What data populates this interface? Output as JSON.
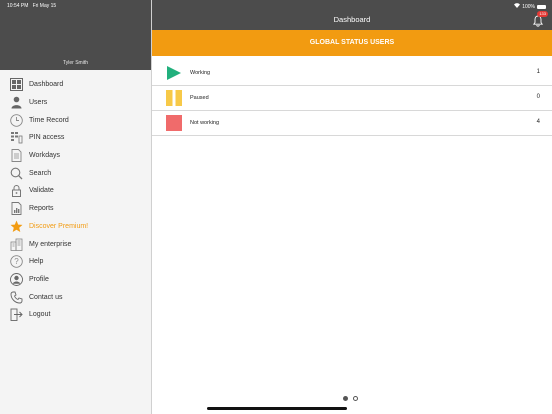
{
  "status_bar": {
    "time": "10:54 PM",
    "date": "Fri May 15",
    "battery": "100%"
  },
  "sidebar": {
    "user_name": "Tyler Smith",
    "items": [
      {
        "label": "Dashboard",
        "icon": "dashboard-icon"
      },
      {
        "label": "Users",
        "icon": "user-icon"
      },
      {
        "label": "Time Record",
        "icon": "clock-icon"
      },
      {
        "label": "PIN access",
        "icon": "keypad-icon"
      },
      {
        "label": "Workdays",
        "icon": "document-icon"
      },
      {
        "label": "Search",
        "icon": "search-icon"
      },
      {
        "label": "Validate",
        "icon": "lock-icon"
      },
      {
        "label": "Reports",
        "icon": "report-icon"
      },
      {
        "label": "Discover Premium!",
        "icon": "star-icon"
      },
      {
        "label": "My enterprise",
        "icon": "building-icon"
      },
      {
        "label": "Help",
        "icon": "help-icon"
      },
      {
        "label": "Profile",
        "icon": "profile-icon"
      },
      {
        "label": "Contact us",
        "icon": "phone-icon"
      },
      {
        "label": "Logout",
        "icon": "logout-icon"
      }
    ]
  },
  "header": {
    "title": "Dashboard",
    "notification_count": "133"
  },
  "banner": {
    "title": "GLOBAL STATUS USERS"
  },
  "status_rows": [
    {
      "label": "Working",
      "count": "1",
      "color": "#22b07d",
      "icon": "play-icon"
    },
    {
      "label": "Paused",
      "count": "0",
      "color": "#f7c948",
      "icon": "pause-icon"
    },
    {
      "label": "Not working",
      "count": "4",
      "color": "#f06b6b",
      "icon": "stop-icon"
    }
  ],
  "pagination": {
    "pages": 2,
    "current": 1
  },
  "colors": {
    "accent": "#f29b11",
    "header_bg": "#4c4c4c",
    "sidebar_bg": "#f4f4f4"
  }
}
